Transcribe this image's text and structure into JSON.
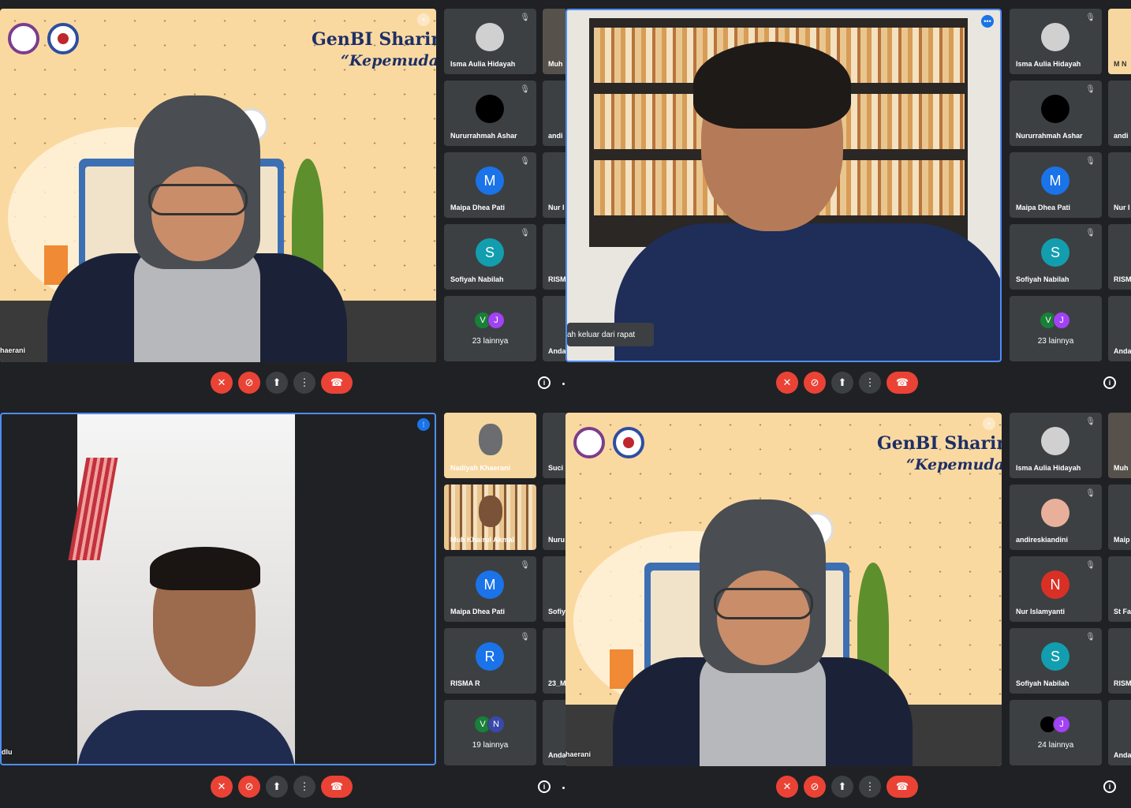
{
  "banner": {
    "title": "GenBI Sharing S",
    "subtitle": "“Kepemudaa"
  },
  "top_left": {
    "speaker_name": "haerani",
    "sidebar": [
      {
        "name": "Isma Aulia Hidayah",
        "avatar": "photo",
        "muted": true
      },
      {
        "name": "Nururrahmah Ashar",
        "avatar": "black",
        "muted": true
      },
      {
        "name": "Maipa Dhea Pati",
        "avatar": "M",
        "color": "#1a73e8",
        "muted": true
      },
      {
        "name": "Sofiyah Nabilah",
        "avatar": "S",
        "color": "#129eaf",
        "muted": true
      },
      {
        "more": "23 lainnya",
        "minis": [
          "V",
          "J"
        ]
      }
    ],
    "edge_names": [
      "Muh",
      "andi",
      "Nur I",
      "RISM",
      "Anda"
    ]
  },
  "top_right": {
    "toast": "ah keluar dari rapat",
    "sidebar": [
      {
        "name": "Isma Aulia Hidayah",
        "avatar": "photo",
        "muted": true
      },
      {
        "name": "Nururrahmah Ashar",
        "avatar": "black",
        "muted": true
      },
      {
        "name": "Maipa Dhea Pati",
        "avatar": "M",
        "color": "#1a73e8",
        "muted": true
      },
      {
        "name": "Sofiyah Nabilah",
        "avatar": "S",
        "color": "#129eaf",
        "muted": true
      },
      {
        "more": "23 lainnya",
        "minis": [
          "V",
          "J"
        ]
      }
    ],
    "edge_names": [
      "M N",
      "andi",
      "Nur I",
      "RISM",
      "Anda"
    ]
  },
  "bottom_left": {
    "speaker_name": "dlu",
    "sidebar": [
      {
        "name": "Nadiyah Khaerani",
        "thumb": "room"
      },
      {
        "name": "Muh Khairul Akmal",
        "thumb": "shelf"
      },
      {
        "name": "Maipa Dhea Pati",
        "avatar": "M",
        "color": "#1a73e8",
        "muted": true
      },
      {
        "name": "RISMA R",
        "avatar": "R",
        "color": "#1a73e8",
        "muted": true
      },
      {
        "more": "19 lainnya",
        "minis": [
          "V",
          "N"
        ]
      }
    ],
    "edge_names": [
      "Suci",
      "Nuru",
      "Sofiy",
      "23_M",
      "Anda"
    ]
  },
  "bottom_right": {
    "speaker_name": "haerani",
    "sidebar": [
      {
        "name": "Isma Aulia Hidayah",
        "avatar": "photo",
        "muted": true
      },
      {
        "name": "andireskiandini",
        "avatar": "peach",
        "muted": true
      },
      {
        "name": "Nur Islamyanti",
        "avatar": "N",
        "color": "#d93025",
        "muted": true
      },
      {
        "name": "Sofiyah Nabilah",
        "avatar": "S",
        "color": "#129eaf",
        "muted": true
      },
      {
        "more": "24 lainnya",
        "minis": [
          "",
          "J"
        ]
      }
    ],
    "edge_names": [
      "Muh",
      "Maip",
      "St Fa",
      "RISM",
      "Anda"
    ]
  },
  "icons": {
    "mic_off": "mic-off-icon",
    "cam_off": "camera-off-icon",
    "present": "present-icon",
    "more": "more-vert-icon",
    "hangup": "hang-up-icon",
    "info": "info-icon"
  },
  "colors": {
    "accent": "#4e8df5",
    "danger": "#ea4335",
    "tile": "#3c4043",
    "bg": "#202124"
  }
}
